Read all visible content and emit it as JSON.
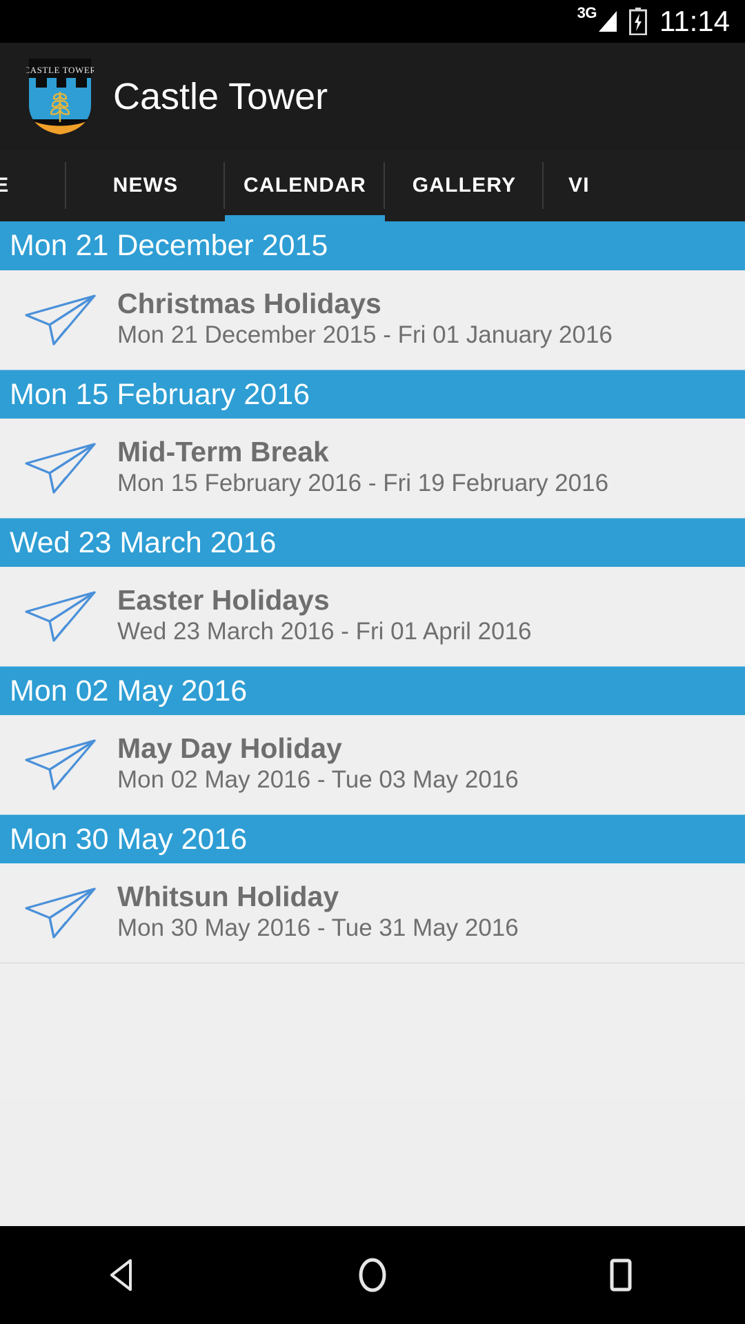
{
  "status_bar": {
    "network": "3G",
    "battery_icon": "battery-charging-icon",
    "signal_icon": "signal-bars-icon",
    "clock": "11:14"
  },
  "app_bar": {
    "logo_icon": "castle-tower-shield-logo",
    "logo_text": "CASTLE TOWER",
    "title": "Castle Tower"
  },
  "tabs": [
    {
      "label": "ME",
      "active": false,
      "clipped": "left"
    },
    {
      "label": "NEWS",
      "active": false,
      "clipped": "none"
    },
    {
      "label": "CALENDAR",
      "active": true,
      "clipped": "none"
    },
    {
      "label": "GALLERY",
      "active": false,
      "clipped": "none"
    },
    {
      "label": "VI",
      "active": false,
      "clipped": "right"
    }
  ],
  "colors": {
    "accent_blue": "#2e9ed4",
    "app_bar_bg": "#1c1c1c",
    "list_bg": "#efefef",
    "title_text": "#6e6e6e",
    "range_text": "#6f6f6f"
  },
  "calendar": {
    "groups": [
      {
        "date_header": "Mon 21 December 2015",
        "event": {
          "icon": "paper-plane-icon",
          "title": "Christmas Holidays",
          "range": "Mon 21 December 2015 - Fri 01 January 2016"
        }
      },
      {
        "date_header": "Mon 15 February 2016",
        "event": {
          "icon": "paper-plane-icon",
          "title": "Mid-Term Break",
          "range": "Mon 15 February 2016 - Fri 19 February 2016"
        }
      },
      {
        "date_header": "Wed 23 March 2016",
        "event": {
          "icon": "paper-plane-icon",
          "title": "Easter Holidays",
          "range": "Wed 23 March 2016 - Fri 01 April 2016"
        }
      },
      {
        "date_header": "Mon 02 May 2016",
        "event": {
          "icon": "paper-plane-icon",
          "title": "May Day Holiday",
          "range": "Mon 02 May 2016 - Tue 03 May 2016"
        }
      },
      {
        "date_header": "Mon 30 May 2016",
        "event": {
          "icon": "paper-plane-icon",
          "title": "Whitsun Holiday",
          "range": "Mon 30 May 2016 - Tue 31 May 2016"
        }
      }
    ]
  },
  "nav_bar": {
    "back": "back-triangle-icon",
    "home": "home-circle-icon",
    "recents": "recents-square-icon"
  }
}
